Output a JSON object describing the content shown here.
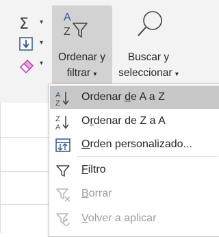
{
  "ribbon": {
    "sort_filter": {
      "line1": "Ordenar y",
      "line2": "filtrar",
      "dropdown_glyph": "▾"
    },
    "find_select": {
      "line1": "Buscar y",
      "line2": "seleccionar",
      "dropdown_glyph": "▾"
    },
    "mini_buttons": [
      {
        "icon": "sigma-icon",
        "dropdown_glyph": "▾"
      },
      {
        "icon": "fill-down-icon",
        "dropdown_glyph": "▾"
      },
      {
        "icon": "eraser-icon",
        "dropdown_glyph": "▾"
      }
    ]
  },
  "menu": {
    "items": [
      {
        "pre": "Ordenar ",
        "accel": "d",
        "post": "e A a Z",
        "icon": "sort-a-to-z-icon",
        "highlighted": true,
        "enabled": true
      },
      {
        "pre": "O",
        "accel": "r",
        "post": "denar de Z a A",
        "icon": "sort-z-to-a-icon",
        "highlighted": false,
        "enabled": true
      },
      {
        "pre": "",
        "accel": "O",
        "post": "rden personalizado...",
        "icon": "custom-sort-icon",
        "highlighted": false,
        "enabled": true
      },
      {
        "pre": "",
        "accel": "F",
        "post": "iltro",
        "icon": "filter-icon",
        "highlighted": false,
        "enabled": true
      },
      {
        "pre": "",
        "accel": "B",
        "post": "orrar",
        "icon": "clear-filter-icon",
        "highlighted": false,
        "enabled": false
      },
      {
        "pre": "",
        "accel": "V",
        "post": "olver a aplicar",
        "icon": "reapply-filter-icon",
        "highlighted": false,
        "enabled": false
      }
    ]
  },
  "colors": {
    "ribbon_bg": "#f3f3f3",
    "selected_button_bg": "#d2d2d2",
    "menu_highlight": "#c8c8c8",
    "accent_blue": "#2b5797",
    "eraser_pink": "#c239b3",
    "disabled_text": "#9c9c9c"
  }
}
